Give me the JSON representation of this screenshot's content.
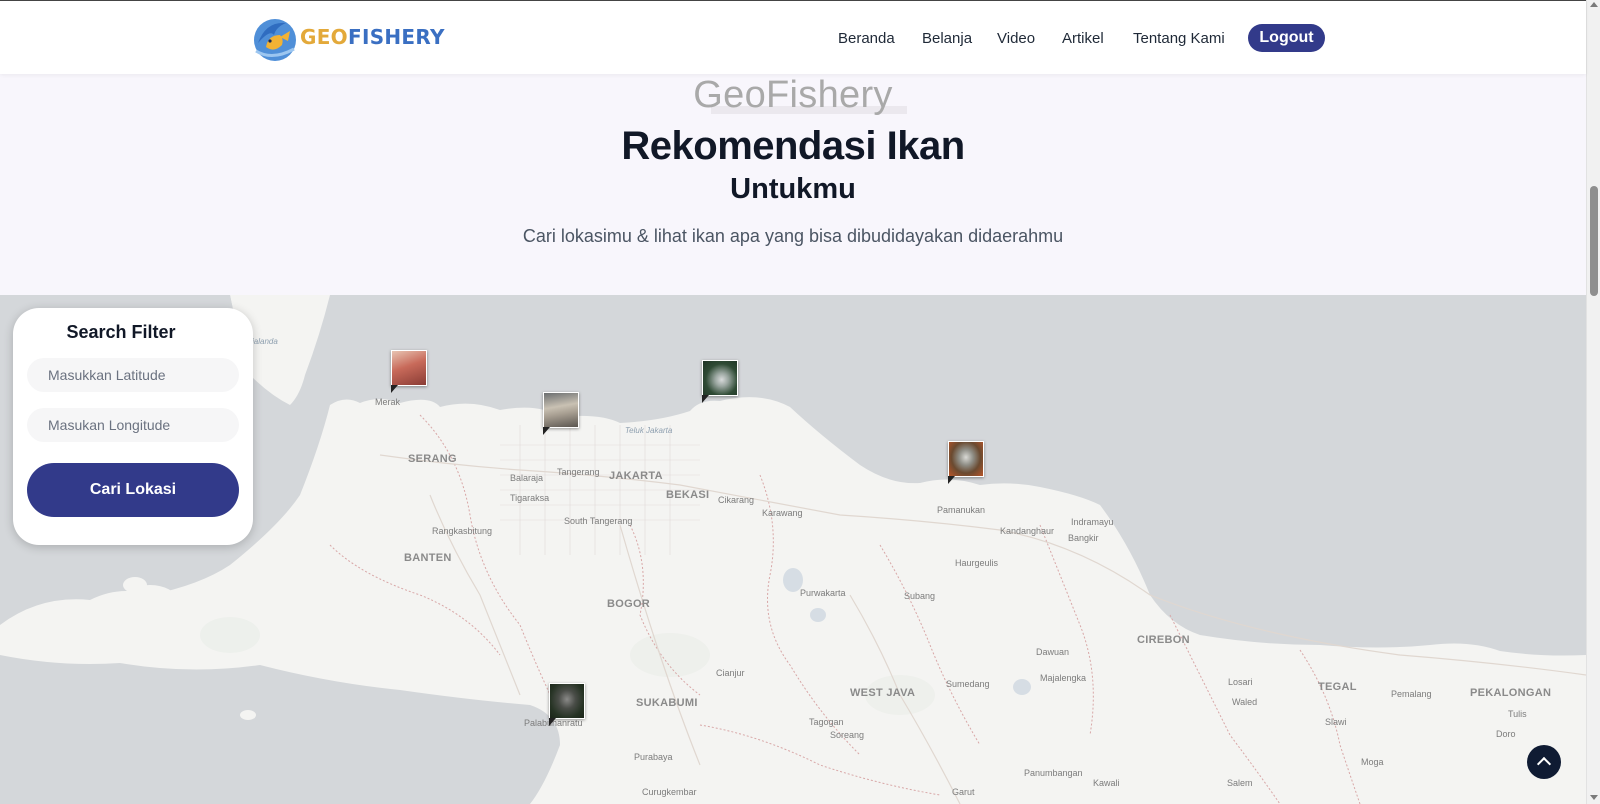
{
  "brand": {
    "logo_geo": "GEO",
    "logo_fishery": "FISHERY"
  },
  "nav": {
    "items": [
      "Beranda",
      "Belanja",
      "Video",
      "Artikel",
      "Tentang Kami"
    ],
    "logout": "Logout"
  },
  "hero": {
    "eyebrow": "GeoFishery",
    "title": "Rekomendasi Ikan",
    "subtitle": "Untukmu",
    "description": "Cari lokasimu & lihat ikan apa yang bisa dibudidayakan didaerahmu"
  },
  "filter": {
    "title": "Search Filter",
    "latitude_placeholder": "Masukkan Latitude",
    "longitude_placeholder": "Masukan Longitude",
    "button": "Cari Lokasi"
  },
  "map": {
    "labels": {
      "merak": "Merak",
      "serang": "SERANG",
      "balaraja": "Balaraja",
      "tigaraksa": "Tigaraksa",
      "tangerang": "Tangerang",
      "jakarta": "JAKARTA",
      "bekasi": "BEKASI",
      "cikarang": "Cikarang",
      "karawang": "Karawang",
      "south_tangerang": "South Tangerang",
      "rangkasbitung": "Rangkasbitung",
      "banten": "BANTEN",
      "bogor": "BOGOR",
      "purwakarta": "Purwakarta",
      "subang": "Subang",
      "pamanukan": "Pamanukan",
      "kandanghaur": "Kandanghaur",
      "indramayu": "Indramayu",
      "bangkir": "Bangkir",
      "haurgeulis": "Haurgeulis",
      "cirebon": "CIREBON",
      "dawuan": "Dawuan",
      "majalengka": "Majalengka",
      "sumedang": "Sumedang",
      "west_java": "WEST JAVA",
      "cianjur": "Cianjur",
      "sukabumi": "SUKABUMI",
      "pelabuhanratu": "Palabuhanratu",
      "purabaya": "Purabaya",
      "tagogan": "Tagogan",
      "soreang": "Soreang",
      "curugkembar": "Curugkembar",
      "garut": "Garut",
      "panumbangan": "Panumbangan",
      "kawali": "Kawali",
      "losari": "Losari",
      "waled": "Waled",
      "tegal": "TEGAL",
      "pemalang": "Pemalang",
      "pekalongan": "PEKALONGAN",
      "slawi": "Slawi",
      "moga": "Moga",
      "salem": "Salem",
      "tulis": "Tulis",
      "doro": "Doro",
      "teluk_jakarta": "Teluk Jakarta",
      "ialanda": "ialanda"
    }
  }
}
